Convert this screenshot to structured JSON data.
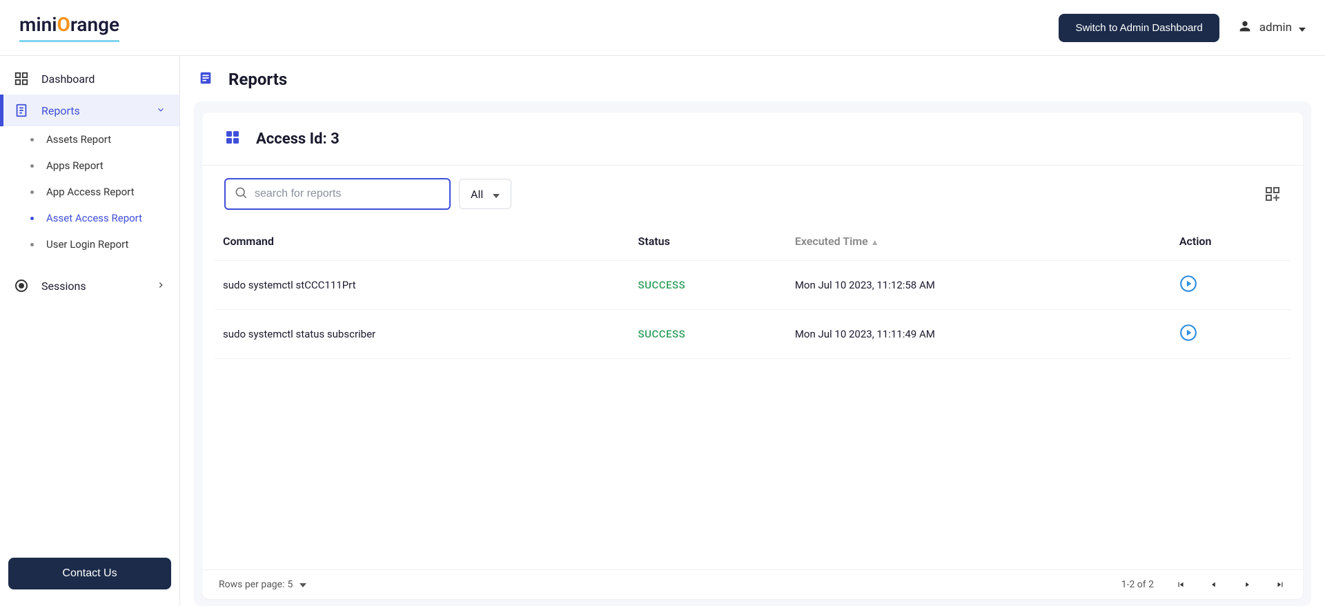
{
  "header": {
    "switch_label": "Switch to Admin Dashboard",
    "user_label": "admin"
  },
  "sidebar": {
    "dashboard": "Dashboard",
    "reports": "Reports",
    "sub": {
      "assets": "Assets Report",
      "apps": "Apps Report",
      "app_access": "App Access Report",
      "asset_access": "Asset Access Report",
      "user_login": "User Login Report"
    },
    "sessions": "Sessions",
    "contact": "Contact Us"
  },
  "main": {
    "title": "Reports",
    "card_title": "Access Id: 3",
    "search_placeholder": "search for reports",
    "filter_label": "All",
    "columns": {
      "command": "Command",
      "status": "Status",
      "executed": "Executed Time",
      "action": "Action"
    },
    "rows": [
      {
        "command": "sudo systemctl stCCC111Prt",
        "status": "SUCCESS",
        "executed": "Mon Jul 10 2023, 11:12:58 AM"
      },
      {
        "command": "sudo systemctl status subscriber",
        "status": "SUCCESS",
        "executed": "Mon Jul 10 2023, 11:11:49 AM"
      }
    ],
    "footer": {
      "rows_label": "Rows per page:",
      "rows_value": "5",
      "range": "1-2 of 2"
    }
  }
}
